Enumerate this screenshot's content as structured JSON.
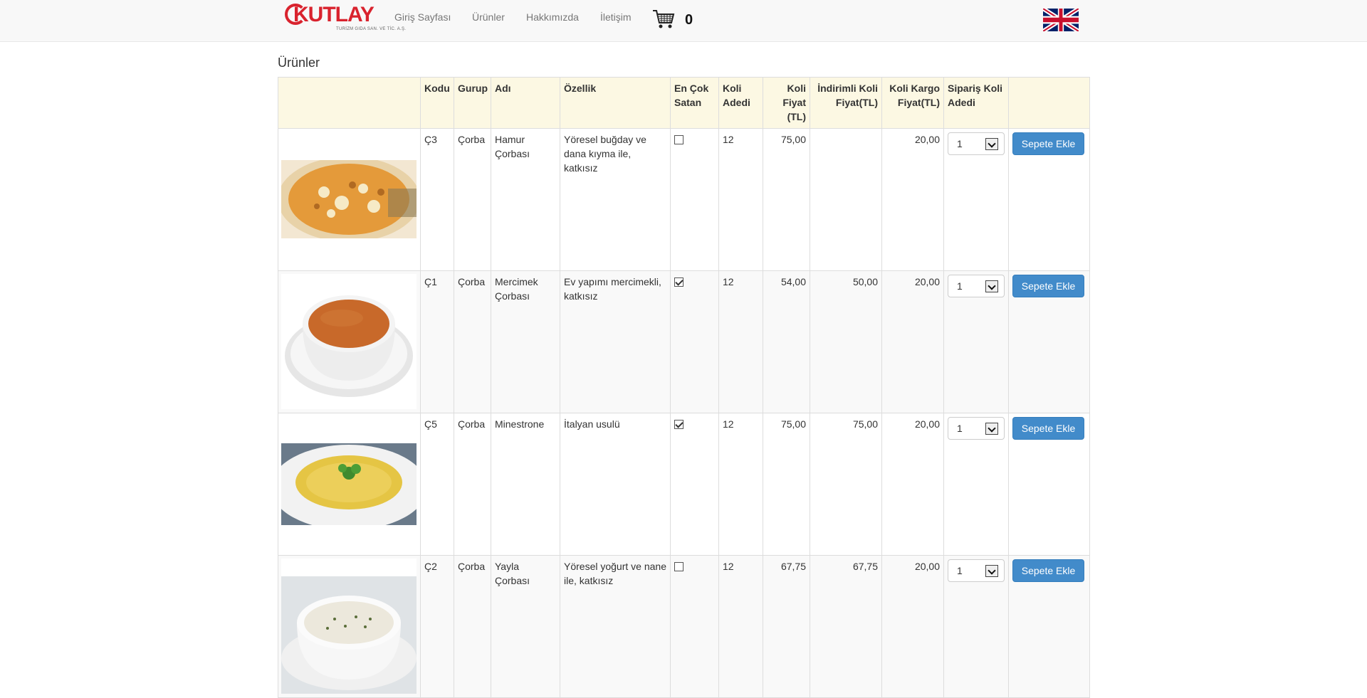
{
  "brand": {
    "logo_text": "KUTLAY",
    "logo_subtitle": "TURİZM GIDA SAN. VE TİC. A.Ş.",
    "accent_color": "#d9232e"
  },
  "nav": {
    "items": [
      {
        "label": "Giriş Sayfası"
      },
      {
        "label": "Ürünler"
      },
      {
        "label": "Hakkımızda"
      },
      {
        "label": "İletişim"
      }
    ],
    "cart_count": "0",
    "cart_icon": "shopping-cart-icon",
    "language_icon": "uk-flag-icon"
  },
  "page": {
    "title": "Ürünler"
  },
  "table": {
    "headers": {
      "image": "",
      "code": "Kodu",
      "group": "Gurup",
      "name": "Adı",
      "feature": "Özellik",
      "bestseller": "En Çok Satan",
      "box_count": "Koli Adedi",
      "box_price": "Koli Fiyat (TL)",
      "discount_price": "İndirimli Koli Fiyat(TL)",
      "shipping_price": "Koli Kargo Fiyat(TL)",
      "order_qty": "Sipariş Koli Adedi",
      "action": ""
    },
    "rows": [
      {
        "code": "Ç3",
        "group": "Çorba",
        "name": "Hamur Çorbası",
        "feature": "Yöresel buğday ve dana kıyma ile, katkısız",
        "bestseller": false,
        "box_count": "12",
        "box_price": "75,00",
        "discount_price": "",
        "shipping_price": "20,00",
        "qty": "1",
        "button": "Sepete Ekle"
      },
      {
        "code": "Ç1",
        "group": "Çorba",
        "name": "Mercimek Çorbası",
        "feature": "Ev yapımı mercimekli, katkısız",
        "bestseller": true,
        "box_count": "12",
        "box_price": "54,00",
        "discount_price": "50,00",
        "shipping_price": "20,00",
        "qty": "1",
        "button": "Sepete Ekle"
      },
      {
        "code": "Ç5",
        "group": "Çorba",
        "name": "Minestrone",
        "feature": "İtalyan usulü",
        "bestseller": true,
        "box_count": "12",
        "box_price": "75,00",
        "discount_price": "75,00",
        "shipping_price": "20,00",
        "qty": "1",
        "button": "Sepete Ekle"
      },
      {
        "code": "Ç2",
        "group": "Çorba",
        "name": "Yayla Çorbası",
        "feature": "Yöresel yoğurt ve nane ile, katkısız",
        "bestseller": false,
        "box_count": "12",
        "box_price": "67,75",
        "discount_price": "67,75",
        "shipping_price": "20,00",
        "qty": "1",
        "button": "Sepete Ekle"
      }
    ]
  }
}
